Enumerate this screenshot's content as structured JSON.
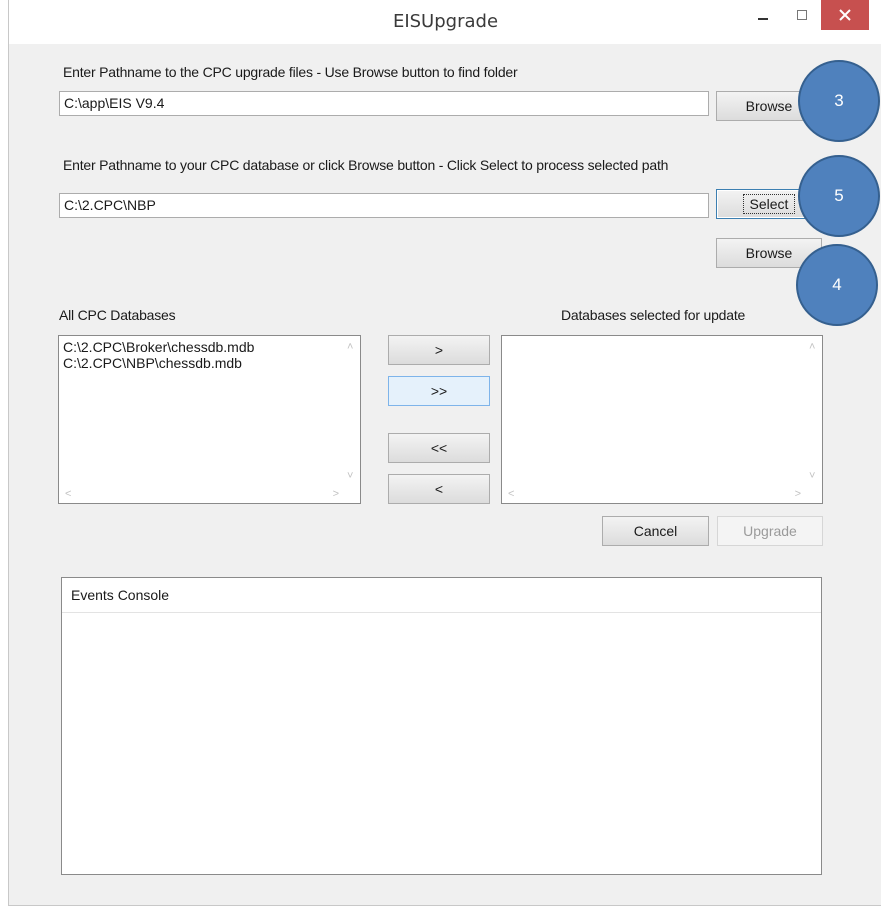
{
  "window": {
    "title": "EISUpgrade",
    "controls": {
      "minimize": "minimize-icon",
      "maximize": "maximize-icon",
      "close": "close-icon"
    }
  },
  "upgrade_path": {
    "label": "Enter Pathname to the CPC upgrade files - Use Browse button to find folder",
    "value": "C:\\app\\EIS V9.4",
    "browse_label": "Browse"
  },
  "database_path": {
    "label": "Enter Pathname to your CPC database or click Browse button    - Click Select to process selected path",
    "value": "C:\\2.CPC\\NBP",
    "select_label": "Select",
    "browse_label": "Browse"
  },
  "all_databases": {
    "label": "All CPC Databases",
    "items": [
      "C:\\2.CPC\\Broker\\chessdb.mdb",
      "C:\\2.CPC\\NBP\\chessdb.mdb"
    ]
  },
  "selected_databases": {
    "label": "Databases selected for update",
    "items": []
  },
  "transfer": {
    "add_one": ">",
    "add_all": ">>",
    "remove_all": "<<",
    "remove_one": "<"
  },
  "actions": {
    "cancel": "Cancel",
    "upgrade": "Upgrade"
  },
  "console": {
    "header": "Events Console"
  },
  "callouts": [
    "3",
    "5",
    "4"
  ],
  "colors": {
    "close_button": "#c7504f",
    "callout_fill": "#4f81bd",
    "callout_border": "#35608f"
  }
}
